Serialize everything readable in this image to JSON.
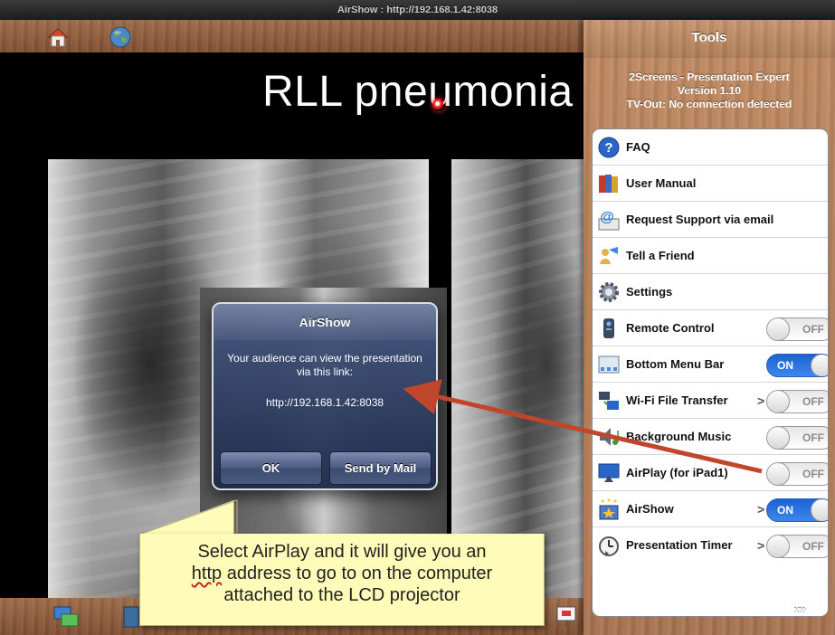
{
  "window": {
    "title": "AirShow : http://192.168.1.42:8038"
  },
  "slide": {
    "title": "RLL pneumonia"
  },
  "dialog": {
    "title": "AirShow",
    "message": "Your audience can view the presentation via this link:",
    "link": "http://192.168.1.42:8038",
    "ok_label": "OK",
    "mail_label": "Send by Mail"
  },
  "callout": {
    "line1": "Select AirPlay and it will give you an",
    "line2_word": "http",
    "line2_rest": " address to go to on the computer",
    "line3": "attached to the LCD projector"
  },
  "tools": {
    "title": "Tools",
    "app_name": "2Screens - Presentation Expert",
    "version": "Version 1.10",
    "tv_out": "TV-Out: No connection detected",
    "more_label": "»",
    "items": [
      {
        "label": "FAQ",
        "icon": "faq-icon"
      },
      {
        "label": "User Manual",
        "icon": "user-manual-icon"
      },
      {
        "label": "Request Support via email",
        "icon": "email-icon"
      },
      {
        "label": "Tell a Friend",
        "icon": "tell-friend-icon"
      },
      {
        "label": "Settings",
        "icon": "settings-icon"
      },
      {
        "label": "Remote Control",
        "icon": "remote-control-icon",
        "toggle": "OFF"
      },
      {
        "label": "Bottom Menu Bar",
        "icon": "bottom-menu-bar-icon",
        "toggle": "ON"
      },
      {
        "label": "Wi-Fi File Transfer",
        "icon": "wifi-transfer-icon",
        "toggle": "OFF",
        "chevron": ">"
      },
      {
        "label": "Background Music",
        "icon": "music-icon",
        "toggle": "OFF"
      },
      {
        "label": "AirPlay (for iPad1)",
        "icon": "airplay-icon",
        "toggle": "OFF"
      },
      {
        "label": "AirShow",
        "icon": "airshow-icon",
        "toggle": "ON",
        "chevron": ">"
      },
      {
        "label": "Presentation Timer",
        "icon": "timer-icon",
        "toggle": "OFF",
        "chevron": ">"
      }
    ]
  },
  "colors": {
    "wood": "#a77353",
    "toggle_on": "#2f75e3",
    "arrow": "#c0462b",
    "callout_bg": "#fffbb8"
  }
}
